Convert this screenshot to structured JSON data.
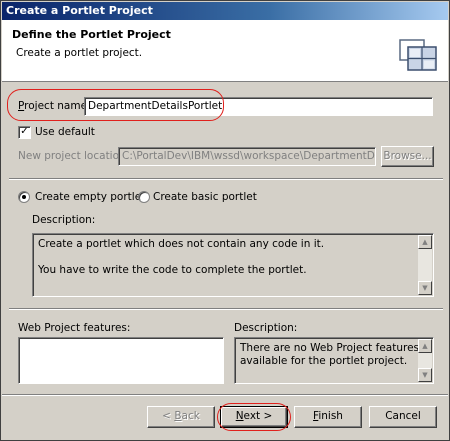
{
  "window": {
    "title": "Create a Portlet Project"
  },
  "header": {
    "title": "Define the Portlet Project",
    "description": "Create a portlet project.",
    "icon": "portlet-wizard-icon"
  },
  "project_name": {
    "label_prefix": "P",
    "label_rest": "roject name:",
    "value": "DepartmentDetailsPortlet"
  },
  "use_default": {
    "label": "Use default",
    "checked": true
  },
  "location": {
    "label": "New project location:",
    "value": "C:\\PortalDev\\IBM\\wssd\\workspace\\DepartmentDetailsPo",
    "browse_label": "Browse..."
  },
  "portlet_type": {
    "options": [
      {
        "label": "Create empty portlet",
        "selected": true
      },
      {
        "label": "Create basic portlet",
        "selected": false
      }
    ],
    "description_label": "Description:",
    "description_line1": "Create a portlet which does not contain any code in it.",
    "description_line2": "You have to write the code to complete the portlet."
  },
  "web_features": {
    "label": "Web Project features:",
    "description_label": "Description:",
    "description_line1": "There are no Web Project features",
    "description_line2": "available for the portlet project."
  },
  "buttons": {
    "back_prefix": "< ",
    "back_mnemonic": "B",
    "back_rest": "ack",
    "next_mnemonic": "N",
    "next_rest": "ext >",
    "finish_mnemonic": "F",
    "finish_rest": "inish",
    "cancel": "Cancel"
  },
  "colors": {
    "titlebar": "#0a246a",
    "annotation": "#e0211d",
    "dialog_bg": "#d4d0c8"
  }
}
